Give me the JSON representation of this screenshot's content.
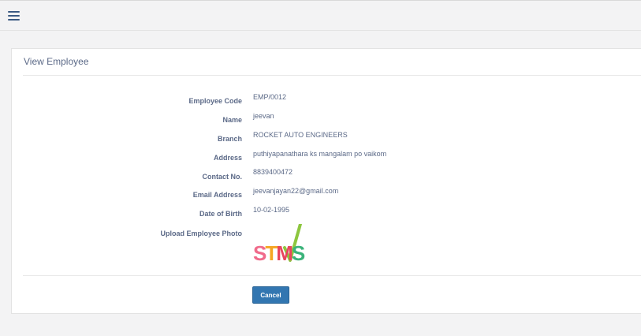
{
  "header": {
    "menu_icon": "hamburger-menu-icon"
  },
  "panel": {
    "title": "View Employee"
  },
  "fields": [
    {
      "label": "Employee Code",
      "value": "EMP/0012"
    },
    {
      "label": "Name",
      "value": "jeevan"
    },
    {
      "label": "Branch",
      "value": "ROCKET AUTO ENGINEERS"
    },
    {
      "label": "Address",
      "value": "puthiyapanathara ks mangalam po vaikom"
    },
    {
      "label": "Contact No.",
      "value": "8839400472"
    },
    {
      "label": "Email Address",
      "value": "jeevanjayan22@gmail.com"
    },
    {
      "label": "Date of Birth",
      "value": "10-02-1995"
    }
  ],
  "photo_field": {
    "label": "Upload Employee Photo",
    "logo_text": "STMS"
  },
  "actions": {
    "cancel_label": "Cancel",
    "button_color": "#3276b1"
  }
}
